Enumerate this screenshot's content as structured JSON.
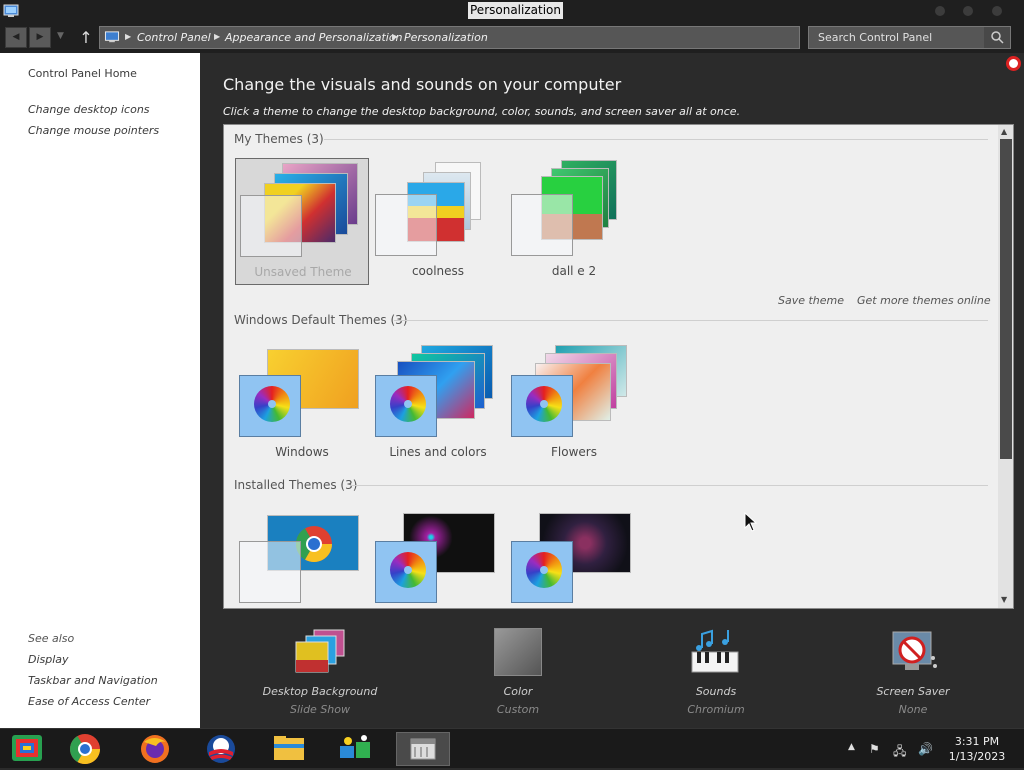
{
  "window": {
    "title": "Personalization"
  },
  "address": {
    "crumbs": [
      "Control Panel",
      "Appearance and Personalization",
      "Personalization"
    ],
    "search_placeholder": "Search Control Panel"
  },
  "sidebar": {
    "home": "Control Panel Home",
    "links": [
      "Change desktop icons",
      "Change mouse pointers"
    ],
    "see_also_title": "See also",
    "see_also": [
      "Display",
      "Taskbar and Navigation",
      "Ease of Access Center"
    ]
  },
  "main": {
    "heading": "Change the visuals and sounds on your computer",
    "subheading": "Click a theme to change the desktop background, color, sounds, and screen saver all at once.",
    "sections": {
      "my": {
        "title": "My Themes (3)",
        "themes": [
          "Unsaved Theme",
          "coolness",
          "dall e 2"
        ]
      },
      "default": {
        "title": "Windows Default Themes (3)",
        "themes": [
          "Windows",
          "Lines and colors",
          "Flowers"
        ]
      },
      "installed": {
        "title": "Installed Themes (3)"
      }
    },
    "actions": {
      "save": "Save theme",
      "more": "Get more themes online"
    }
  },
  "bottom": [
    {
      "label": "Desktop Background",
      "sub": "Slide Show"
    },
    {
      "label": "Color",
      "sub": "Custom"
    },
    {
      "label": "Sounds",
      "sub": "Chromium"
    },
    {
      "label": "Screen Saver",
      "sub": "None"
    }
  ],
  "taskbar": {
    "apps": [
      "control-panel-icon",
      "chrome-icon",
      "firefox-icon",
      "obama-icon",
      "file-explorer-icon",
      "network-app-icon",
      "personalization-window-icon"
    ],
    "time": "3:31 PM",
    "date": "1/13/2023"
  }
}
